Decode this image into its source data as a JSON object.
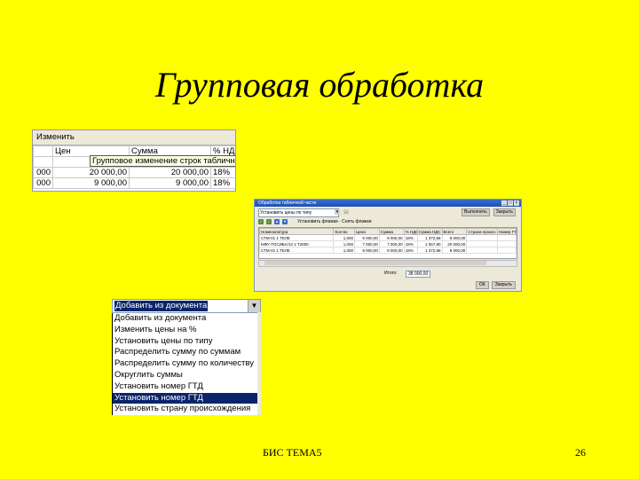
{
  "slide": {
    "title": "Групповая обработка",
    "footer_center": "БИС ТЕМА5",
    "page_number": "26"
  },
  "table_fragment": {
    "change_button": "Изменить",
    "header_cells": [
      "",
      "Цен",
      "Сумма",
      "% НДС"
    ],
    "tooltip": "Групповое изменение строк табличной части",
    "rows": [
      [
        "000",
        "20 000,00",
        "20 000,00",
        "18%"
      ],
      [
        "000",
        "9 000,00",
        "9 000,00",
        "18%"
      ]
    ]
  },
  "main_window": {
    "title": "Обработка табличной части",
    "select_value": "Установить цены по типу",
    "buttons": [
      "Выполнить",
      "Закрыть"
    ],
    "toolbar_text": "Установить флажки · Снять флажки",
    "columns": [
      "Номенклатура",
      "Кол-во",
      "Цена",
      "Сумма",
      "% НДС",
      "Сумма НДС",
      "Всего",
      "Страна происх.",
      "Номер ГТД"
    ],
    "rows": [
      [
        "СТМ-01 1 ТЕЛЕ",
        "1,000",
        "9 000,00",
        "9 000,00",
        "18%",
        "1 372,88",
        "9 000,00",
        "",
        ""
      ],
      [
        "МФУ-ТОСИБА/13 1 Т2000",
        "1,000",
        "7 000,00",
        "7 000,00",
        "18%",
        "1 067,80",
        "20 000,00",
        "",
        ""
      ],
      [
        "СТМ-01 1 ТЕЛЕ",
        "1,000",
        "9 000,00",
        "9 000,00",
        "18%",
        "1 372,88",
        "9 000,00",
        "",
        ""
      ]
    ],
    "totals_label": "Итого:",
    "totals_value": "38 000,00",
    "footer_buttons": [
      "ОК",
      "Закрыть"
    ]
  },
  "dropdown": {
    "selected_value": "Добавить из документа",
    "items": [
      "Добавить из документа",
      "Изменить цены на %",
      "Установить цены по типу",
      "Распределить сумму по суммам",
      "Распределить сумму по количеству",
      "Округлить суммы",
      "Установить номер ГТД",
      "Установить номер ГТД",
      "Установить страну происхождения"
    ],
    "selected_index": 7
  },
  "colors": {
    "background": "#ffff00",
    "selection": "#0a246a"
  }
}
